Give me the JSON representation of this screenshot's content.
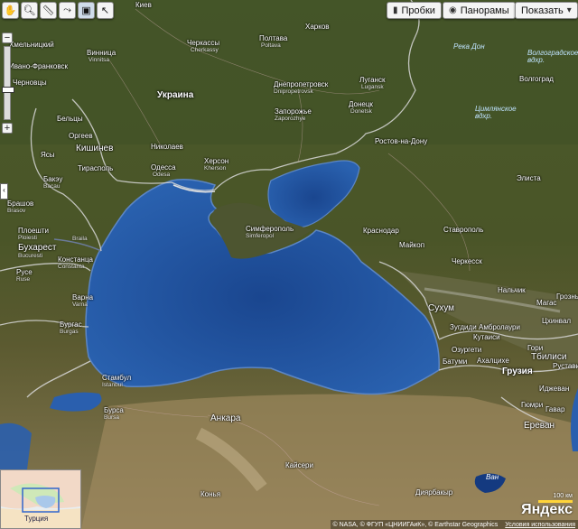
{
  "toolbar": {
    "traffic_label": "Пробки",
    "panoramas_label": "Панорамы",
    "show_label": "Показать"
  },
  "countries": {
    "ukraine": "Украина",
    "georgia": "Грузия",
    "turkey": "Турция"
  },
  "water": {
    "don": "Река Дон",
    "volgograd_res": "Волгоградское вдхр.",
    "tsimlyansk_res": "Цимлянское вдхр.",
    "van": "Ван"
  },
  "cities": {
    "kiev": "Киев",
    "kharkov": "Харков",
    "cherkassy": "Черкассы",
    "cherkassy_lat": "Cherkassy",
    "poltava": "Полтава",
    "poltava_lat": "Poltava",
    "vinnitsa": "Винница",
    "vinnitsa_lat": "Vinnitsa",
    "chernovtsy": "Черновцы",
    "khmelnitsky": "Хмельницкий",
    "ivano": "Ивано-Франковск",
    "dnepropetrovsk": "Днепропетровск",
    "dnepropetrovsk_lat": "Dnipropetrovsk",
    "lugansk": "Луганск",
    "lugansk_lat": "Lugansk",
    "zaporozhe": "Запорожье",
    "zaporozhe_lat": "Zaporozhye",
    "donetsk": "Донецк",
    "donetsk_lat": "Donetsk",
    "volgograd": "Волгоград",
    "beltsy": "Бельцы",
    "orgeev": "Оргеев",
    "kishinev": "Кишинев",
    "nikolaev": "Николаев",
    "rostov": "Ростов-на-Дону",
    "yassy": "Ясы",
    "tiraspol": "Тирасполь",
    "odessa": "Одесса",
    "odessa_lat": "Odesa",
    "kherson": "Херсон",
    "kherson_lat": "Kherson",
    "bakeu": "Бакэу",
    "bakeu_lat": "Bacau",
    "elista": "Элиста",
    "brashov": "Брашов",
    "brashov_lat": "Brasov",
    "simferopol": "Симферополь",
    "simferopol_lat": "Simferopol",
    "krasnodar": "Краснодар",
    "stavropol": "Ставрополь",
    "ploeshti": "Плоешти",
    "ploeshti_lat": "Ploiesti",
    "braila": "Braila",
    "maikop": "Майкоп",
    "bukharest": "Бухарест",
    "bukharest_lat": "Bucuresti",
    "konstanta": "Констанца",
    "konstanta_lat": "Constanta",
    "cherkessk": "Черкесск",
    "ruse": "Русе",
    "ruse_lat": "Ruse",
    "nalchik": "Нальчик",
    "magas": "Магас",
    "grozny": "Грозны",
    "varna": "Варна",
    "varna_lat": "Varna",
    "sukhum": "Сухум",
    "zugdidi": "Зугдиди",
    "ambrolauri": "Амбролаури",
    "tskhinval": "Цхинвал",
    "kutaisi": "Кутаиси",
    "burgas": "Бургас",
    "burgas_lat": "Burgas",
    "ozurgeti": "Озургети",
    "gori": "Гори",
    "batumi": "Батуми",
    "akhaltsikhe": "Ахалцихе",
    "tbilisi": "Тбилиси",
    "rustavi": "Рустави",
    "istanbul": "Стамбул",
    "istanbul_lat": "Istanbul",
    "izhevan": "Иджеван",
    "bursa": "Бурса",
    "bursa_lat": "Bursa",
    "gyumri": "Гюмри",
    "gavar": "Гавар",
    "yerevan": "Ереван",
    "ankara": "Анкара",
    "kayseri": "Кайсери",
    "konya": "Конья",
    "diyarbakir": "Диярбакыр"
  },
  "scale_label": "100 км",
  "logo": "Яндекс",
  "copyright": {
    "text": "© NASA, © ФГУП «ЦНИИГАиК», © Earthstar Geographics",
    "terms": "Условия использования"
  },
  "colors": {
    "sea": "#1d4e9c",
    "land": "#4a5029",
    "borders": "#d6d6d6"
  }
}
